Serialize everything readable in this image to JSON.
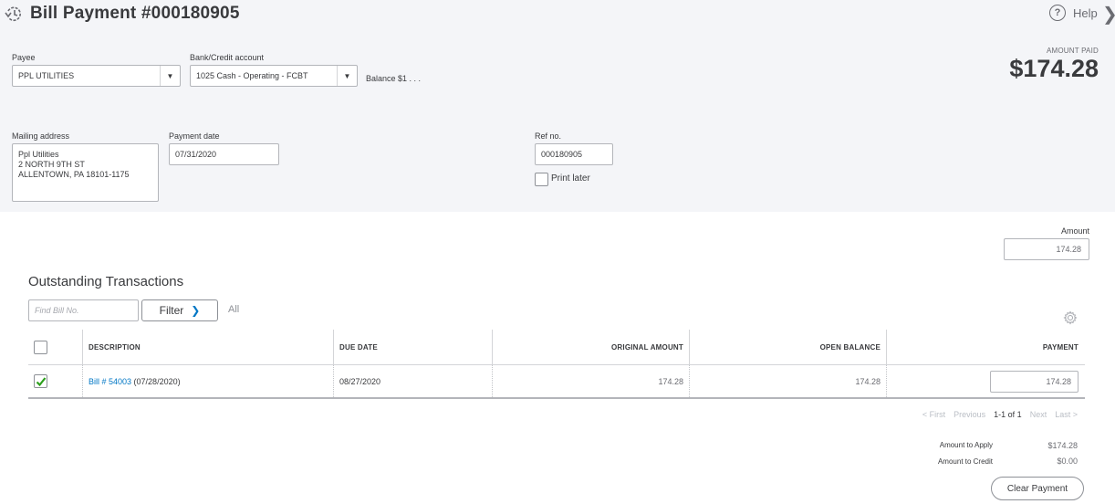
{
  "header": {
    "title": "Bill Payment #000180905",
    "title_icon": "history-clock-icon",
    "help_label": "Help",
    "help_icon": "question-circle-icon",
    "close_icon": "chevron-right-icon"
  },
  "form": {
    "payee": {
      "label": "Payee",
      "value": "PPL UTILITIES"
    },
    "bank_account": {
      "label": "Bank/Credit account",
      "value": "1025 Cash - Operating - FCBT"
    },
    "balance_text": "Balance $1 .  .  .",
    "amount_paid": {
      "label": "AMOUNT PAID",
      "value": "$174.28"
    },
    "mailing_address": {
      "label": "Mailing address",
      "lines": [
        "Ppl Utilities",
        "2 NORTH 9TH ST",
        "ALLENTOWN, PA  18101-1175"
      ]
    },
    "payment_date": {
      "label": "Payment date",
      "value": "07/31/2020"
    },
    "ref_no": {
      "label": "Ref no.",
      "value": "000180905"
    },
    "print_later": {
      "label": "Print later",
      "checked": false
    }
  },
  "amount": {
    "label": "Amount",
    "value": "174.28"
  },
  "outstanding": {
    "title": "Outstanding Transactions",
    "find_placeholder": "Find Bill No.",
    "filter_label": "Filter",
    "filter_scope": "All",
    "settings_icon": "gear-icon",
    "columns": [
      "DESCRIPTION",
      "DUE DATE",
      "ORIGINAL AMOUNT",
      "OPEN BALANCE",
      "PAYMENT"
    ],
    "rows": [
      {
        "checked": true,
        "bill_link": "Bill # 54003",
        "bill_date": " (07/28/2020)",
        "due_date": "08/27/2020",
        "original_amount": "174.28",
        "open_balance": "174.28",
        "payment": "174.28"
      }
    ],
    "pager": {
      "first": "< First",
      "previous": "Previous",
      "current": "1-1 of 1",
      "next": "Next",
      "last": "Last >"
    }
  },
  "summary": {
    "amount_to_apply": {
      "label": "Amount to Apply",
      "value": "$174.28"
    },
    "amount_to_credit": {
      "label": "Amount to Credit",
      "value": "$0.00"
    },
    "clear_payment_label": "Clear Payment"
  },
  "colors": {
    "header_bg": "#f4f5f8",
    "link": "#0077c5",
    "check_green": "#2ca01c"
  }
}
